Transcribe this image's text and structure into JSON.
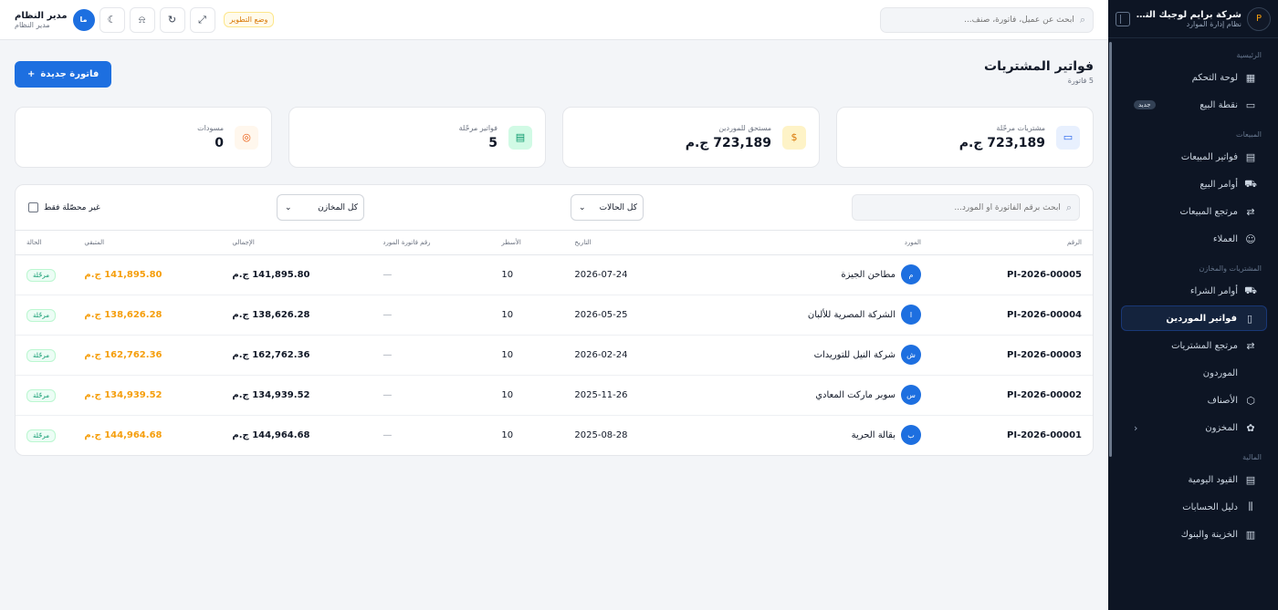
{
  "sidebar": {
    "logo": "P",
    "brand": "شركة برايم لوجيك التجر...",
    "subtitle": "نظام إدارة الموارد",
    "sections": {
      "home": "الرئيسية",
      "sales": "المبيعات",
      "purchases": "المشتريات والمخازن",
      "finance": "المالية"
    },
    "items": [
      {
        "label": "لوحة التحكم",
        "icon": "grid-icon"
      },
      {
        "label": "نقطة البيع",
        "icon": "wallet-icon",
        "badge": "جديد"
      },
      {
        "label": "فواتير المبيعات",
        "icon": "receipt-icon"
      },
      {
        "label": "أوامر البيع",
        "icon": "cart-icon"
      },
      {
        "label": "مرتجع المبيعات",
        "icon": "swap-icon"
      },
      {
        "label": "العملاء",
        "icon": "users-icon"
      },
      {
        "label": "أوامر الشراء",
        "icon": "truck-icon"
      },
      {
        "label": "فواتير الموردين",
        "icon": "file-icon",
        "active": true
      },
      {
        "label": "مرتجع المشتريات",
        "icon": "swap-icon"
      },
      {
        "label": "الموردون",
        "icon": "supplier-icon"
      },
      {
        "label": "الأصناف",
        "icon": "box-icon"
      },
      {
        "label": "المخزون",
        "icon": "boxes-icon"
      },
      {
        "label": "القيود اليومية",
        "icon": "journal-icon"
      },
      {
        "label": "دليل الحسابات",
        "icon": "chart-accounts-icon"
      },
      {
        "label": "الخزينة والبنوك",
        "icon": "bank-icon"
      }
    ]
  },
  "topbar": {
    "search_placeholder": "ابحث عن عميل، فاتورة، صنف...",
    "dev_mode": "وضع التطوير",
    "user_initials": "ما",
    "user_name": "مدير النظام",
    "user_role": "مدير النظام"
  },
  "page": {
    "title": "فواتير المشتريات",
    "count": "5 فاتورة",
    "new_button": "فاتورة جديدة"
  },
  "cards": [
    {
      "label": "مشتريات مرحّلة",
      "value": "723,189 ج.م",
      "icon": "wallet-icon",
      "tone": "blue"
    },
    {
      "label": "مستحق للموردين",
      "value": "723,189 ج.م",
      "icon": "coin-icon",
      "tone": "amber"
    },
    {
      "label": "فواتير مرحّلة",
      "value": "5",
      "icon": "file-icon",
      "tone": "teal"
    },
    {
      "label": "مسودات",
      "value": "0",
      "icon": "draft-icon",
      "tone": "orange"
    }
  ],
  "filters": {
    "search_placeholder": "ابحث برقم الفاتورة أو المورد...",
    "status_select": "كل الحالات",
    "warehouse_select": "كل المخازن",
    "unpaid_only": "غير محصّلة فقط"
  },
  "table": {
    "headers": {
      "number": "الرقم",
      "supplier": "المورد",
      "date": "التاريخ",
      "lines": "الأسطر",
      "supplier_ref": "رقم فاتورة المورد",
      "total": "الإجمالي",
      "due": "المتبقي",
      "status": "الحالة"
    },
    "rows": [
      {
        "number": "PI-2026-00005",
        "initial": "م",
        "supplier": "مطاحن الجيزة",
        "date": "2026-07-24",
        "lines": "10",
        "ref": "—",
        "total": "141,895.80 ج.م",
        "due": "141,895.80 ج.م",
        "status": "مرحّلة"
      },
      {
        "number": "PI-2026-00004",
        "initial": "ا",
        "supplier": "الشركة المصرية للألبان",
        "date": "2026-05-25",
        "lines": "10",
        "ref": "—",
        "total": "138,626.28 ج.م",
        "due": "138,626.28 ج.م",
        "status": "مرحّلة"
      },
      {
        "number": "PI-2026-00003",
        "initial": "ش",
        "supplier": "شركة النيل للتوريدات",
        "date": "2026-02-24",
        "lines": "10",
        "ref": "—",
        "total": "162,762.36 ج.م",
        "due": "162,762.36 ج.م",
        "status": "مرحّلة"
      },
      {
        "number": "PI-2026-00002",
        "initial": "س",
        "supplier": "سوبر ماركت المعادي",
        "date": "2025-11-26",
        "lines": "10",
        "ref": "—",
        "total": "134,939.52 ج.م",
        "due": "134,939.52 ج.م",
        "status": "مرحّلة"
      },
      {
        "number": "PI-2026-00001",
        "initial": "ب",
        "supplier": "بقالة الحرية",
        "date": "2025-08-28",
        "lines": "10",
        "ref": "—",
        "total": "144,964.68 ج.م",
        "due": "144,964.68 ج.م",
        "status": "مرحّلة"
      }
    ]
  }
}
